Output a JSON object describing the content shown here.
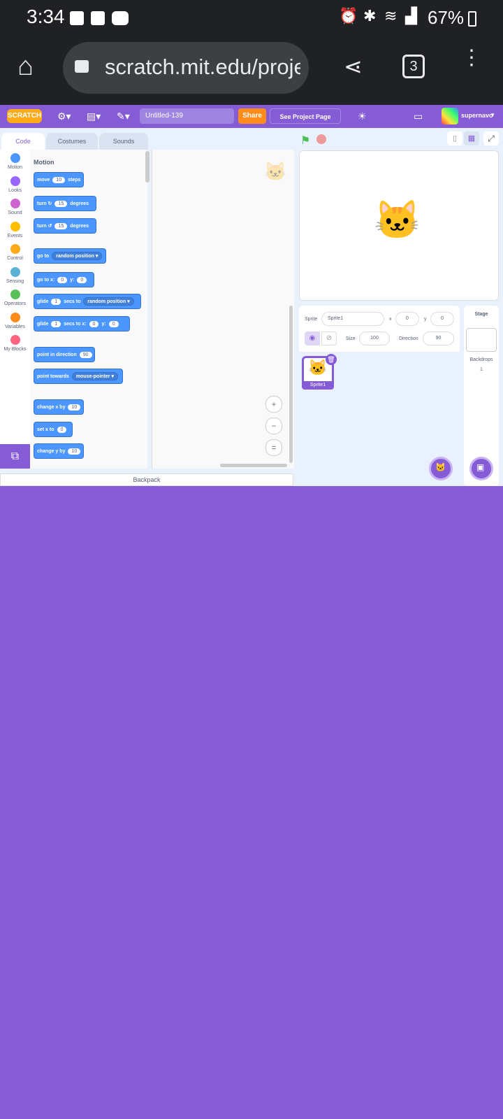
{
  "status_bar": {
    "time": "3:34",
    "battery": "67%"
  },
  "browser": {
    "url": "scratch.mit.edu/proje",
    "tab_count": "3"
  },
  "menu": {
    "title": "Untitled-139",
    "share": "Share",
    "project_page": "See Project Page",
    "username": "supernavo"
  },
  "tabs": [
    "Code",
    "Costumes",
    "Sounds"
  ],
  "categories": [
    "Motion",
    "Looks",
    "Sound",
    "Events",
    "Control",
    "Sensing",
    "Operators",
    "Variables",
    "My Blocks"
  ],
  "category_colors": [
    "#4c97ff",
    "#9966ff",
    "#cf63cf",
    "#ffbf00",
    "#ffab19",
    "#5cb1d6",
    "#59c059",
    "#ff8c1a",
    "#ff6680"
  ],
  "palette_heading": "Motion",
  "blocks": {
    "b1": [
      "move",
      "10",
      "steps"
    ],
    "b2": [
      "turn",
      "15",
      "degrees"
    ],
    "b3": [
      "turn",
      "15",
      "degrees"
    ],
    "b4": [
      "go to",
      "random position"
    ],
    "b5": [
      "go to x:",
      "0",
      "y:",
      "0"
    ],
    "b6": [
      "glide",
      "1",
      "secs to",
      "random position"
    ],
    "b7": [
      "glide",
      "1",
      "secs to x:",
      "0",
      "y:",
      "0"
    ],
    "b8": [
      "point in direction",
      "90"
    ],
    "b9": [
      "point towards",
      "mouse-pointer"
    ],
    "b10": [
      "change x by",
      "10"
    ],
    "b11": [
      "set x to",
      "0"
    ],
    "b12": [
      "change y by",
      "10"
    ]
  },
  "backpack": "Backpack",
  "sprite_info": {
    "sprite_label": "Sprite",
    "sprite_name": "Sprite1",
    "x_label": "x",
    "x": "0",
    "y_label": "y",
    "y": "0",
    "size_label": "Size",
    "size": "100",
    "direction_label": "Direction",
    "direction": "90"
  },
  "sprite_tile": "Sprite1",
  "stage_panel": {
    "title": "Stage",
    "backdrops_label": "Backdrops",
    "backdrops_count": "1"
  }
}
